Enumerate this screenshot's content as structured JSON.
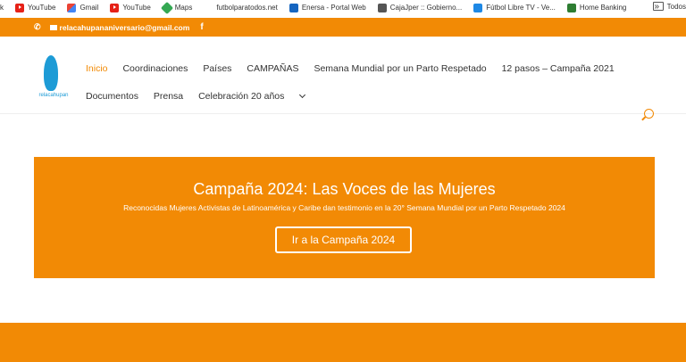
{
  "bookmarks": [
    {
      "label": "k",
      "icon": "blank-icon"
    },
    {
      "label": "YouTube",
      "icon": "youtube-icon"
    },
    {
      "label": "Gmail",
      "icon": "gmail-icon"
    },
    {
      "label": "YouTube",
      "icon": "youtube-icon"
    },
    {
      "label": "Maps",
      "icon": "maps-icon"
    },
    {
      "label": "futbolparatodos.net",
      "icon": "blank-icon"
    },
    {
      "label": "Enersa - Portal Web",
      "icon": "enersa-icon"
    },
    {
      "label": "CajaJper :: Gobierno...",
      "icon": "caja-icon"
    },
    {
      "label": "Fútbol Libre TV - Ve...",
      "icon": "futbol-libre-icon"
    },
    {
      "label": "Home Banking",
      "icon": "home-banking-icon"
    }
  ],
  "bookmarks_more": "»",
  "bookmarks_all": "Todos",
  "contact": {
    "email": "relacahupananiversario@gmail.com",
    "facebook": "f"
  },
  "logo_text": "relacahupan",
  "nav": {
    "items": [
      "Inicio",
      "Coordinaciones",
      "Países",
      "CAMPAÑAS",
      "Semana Mundial por un Parto Respetado",
      "12 pasos – Campaña 2021",
      "Documentos",
      "Prensa",
      "Celebración 20 años"
    ],
    "active": "Inicio"
  },
  "banner": {
    "title": "Campaña 2024: Las Voces de las Mujeres",
    "subtitle": "Reconocidas Mujeres Activistas de Latinoamérica y Caribe dan testimonio en la 20° Semana Mundial por un Parto Respetado 2024",
    "button": "Ir a la Campaña 2024"
  },
  "colors": {
    "accent": "#f28a05",
    "logo": "#1d9bd6"
  }
}
